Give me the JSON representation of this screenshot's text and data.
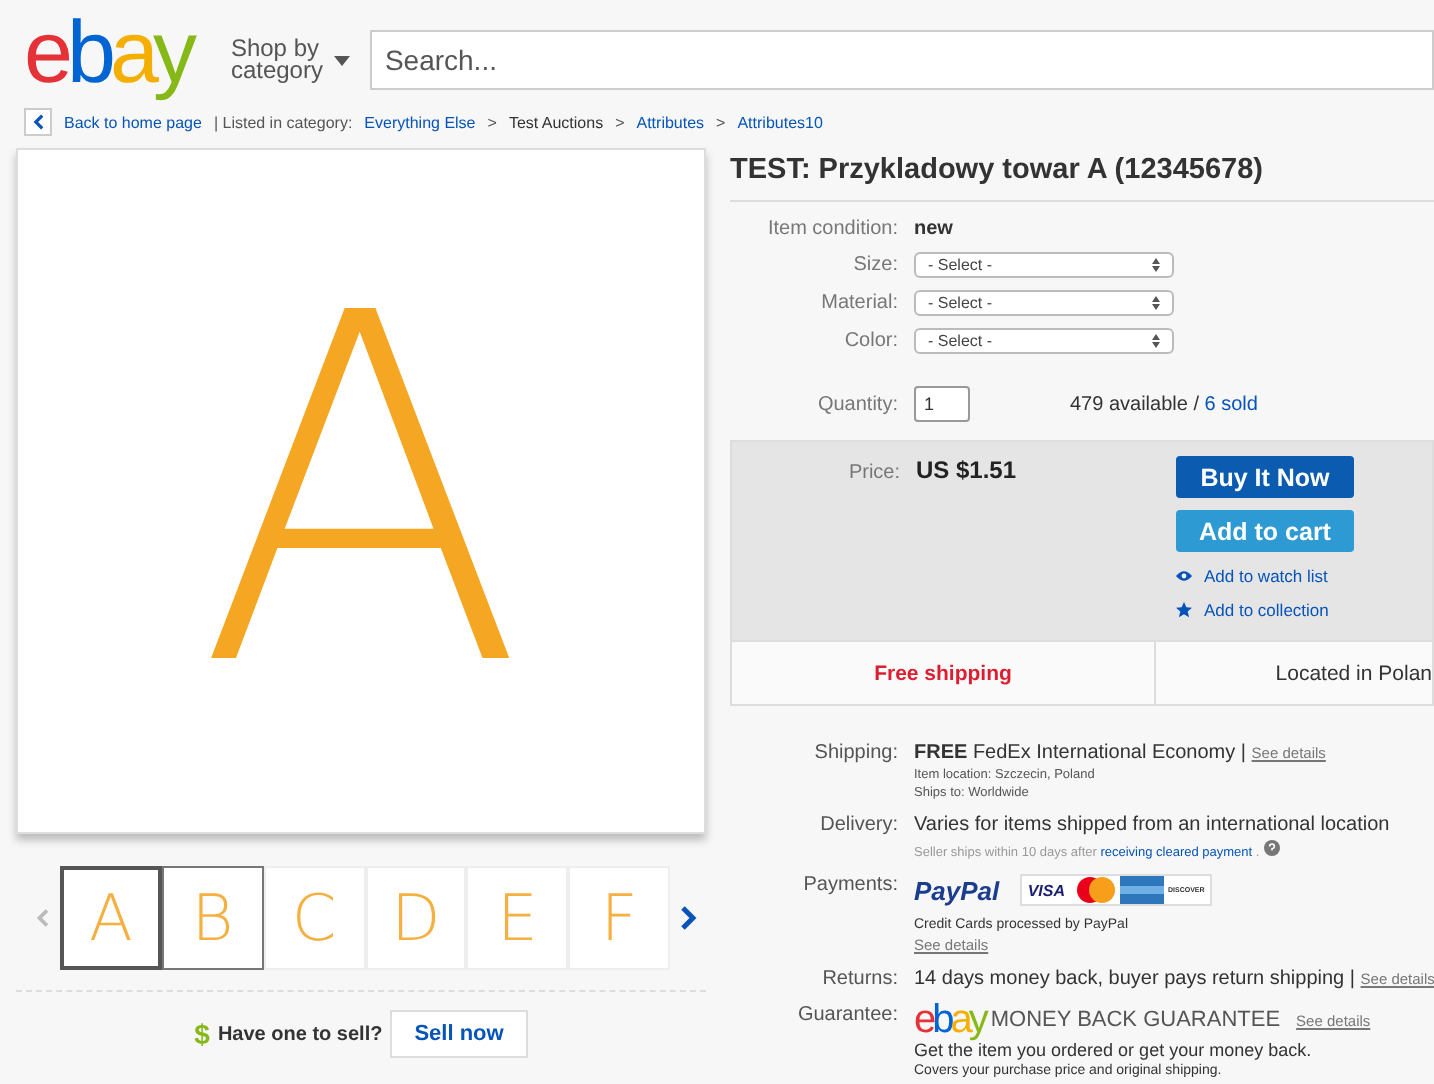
{
  "header": {
    "logo": [
      {
        "text": "e",
        "color": "#e53238"
      },
      {
        "text": "b",
        "color": "#0064d2"
      },
      {
        "text": "a",
        "color": "#f5af02"
      },
      {
        "text": "y",
        "color": "#86b817"
      }
    ],
    "shop_by": "Shop by category",
    "search": {
      "placeholder": "Search..."
    }
  },
  "breadcrumb": {
    "back": "Back to home page",
    "label": "| Listed in category:",
    "path": [
      "Everything Else",
      "Test Auctions",
      "Attributes",
      "Attributes10"
    ],
    "separators": [
      ">",
      ">",
      ">"
    ]
  },
  "gallery": {
    "image_letter": "A",
    "thumbnails": [
      {
        "letter": "A",
        "selected": true,
        "hovered": false
      },
      {
        "letter": "B",
        "selected": false,
        "hovered": true
      },
      {
        "letter": "C",
        "selected": false,
        "hovered": false
      },
      {
        "letter": "D",
        "selected": false,
        "hovered": false
      },
      {
        "letter": "E",
        "selected": false,
        "hovered": false
      },
      {
        "letter": "F",
        "selected": false,
        "hovered": false
      }
    ]
  },
  "sell": {
    "symbol": "$",
    "question": "Have one to sell?",
    "button": "Sell now"
  },
  "item": {
    "title": "TEST: Przykladowy towar A (12345678)",
    "condition": {
      "label": "Item condition:",
      "value": "new"
    },
    "options": [
      {
        "label": "Size:",
        "value": "- Select -"
      },
      {
        "label": "Material:",
        "value": "- Select -"
      },
      {
        "label": "Color:",
        "value": "- Select -"
      }
    ],
    "quantity": {
      "label": "Quantity:",
      "value": "1",
      "available": "479 available /",
      "sold": "6 sold"
    }
  },
  "buy_box": {
    "price_label": "Price:",
    "price": "US $1.51",
    "buy_now": "Buy It Now",
    "add_to_cart": "Add to cart",
    "watch": "Add to watch list",
    "collection": "Add to collection"
  },
  "shipping_bar": {
    "free": "Free shipping",
    "location": "Located in Polan"
  },
  "details": [
    {
      "label": "Shipping:",
      "kind": "shipping",
      "strong": "FREE",
      "main": "FedEx International Economy |",
      "link": "See details",
      "lines": [
        "Item location:  Szczecin, Poland",
        "Ships to:  Worldwide"
      ]
    },
    {
      "label": "Delivery:",
      "kind": "delivery",
      "main": "Varies for items shipped from an international location",
      "note": "Seller ships within 10 days after",
      "note_link": "receiving cleared payment",
      "note_end": "."
    },
    {
      "label": "Payments:",
      "kind": "payments",
      "paypal": "PayPal",
      "cards": [
        {
          "kind": "visa",
          "text": "VISA"
        },
        {
          "kind": "mastercard"
        },
        {
          "kind": "amex"
        },
        {
          "kind": "discover",
          "text": "DISCOVER"
        }
      ],
      "note": "Credit Cards processed by PayPal",
      "link": "See details"
    },
    {
      "label": "Returns:",
      "kind": "returns",
      "main": "14 days money back, buyer pays return shipping |",
      "link": "See details"
    },
    {
      "label": "Guarantee:",
      "kind": "guarantee",
      "logo": [
        {
          "text": "e",
          "color": "#e53238"
        },
        {
          "text": "b",
          "color": "#0064d2"
        },
        {
          "text": "a",
          "color": "#f5af02"
        },
        {
          "text": "y",
          "color": "#86b817"
        }
      ],
      "main": "MONEY BACK GUARANTEE",
      "link": "See details",
      "lines": [
        "Get the item you ordered or get your money back.",
        "Covers your purchase price and original shipping."
      ]
    }
  ]
}
